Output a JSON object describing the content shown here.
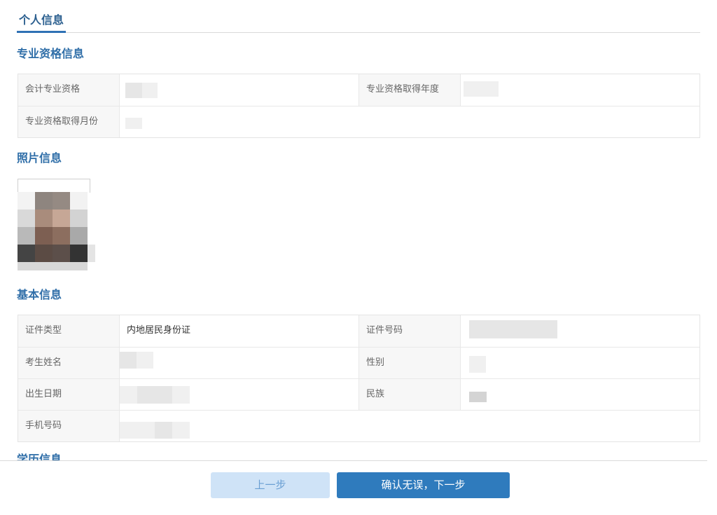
{
  "tabs": {
    "active_tab": "个人信息"
  },
  "sections": {
    "professional": "专业资格信息",
    "photo": "照片信息",
    "basic": "基本信息",
    "education": "学历信息"
  },
  "professional_fields": {
    "qualification_label": "会计专业资格",
    "year_label": "专业资格取得年度",
    "month_label": "专业资格取得月份"
  },
  "basic_fields": {
    "id_type_label": "证件类型",
    "id_type_value": "内地居民身份证",
    "id_number_label": "证件号码",
    "name_label": "考生姓名",
    "gender_label": "性别",
    "birth_label": "出生日期",
    "ethnicity_label": "民族",
    "phone_label": "手机号码"
  },
  "buttons": {
    "prev": "上一步",
    "next": "确认无误，下一步"
  },
  "colors": {
    "accent": "#2f7bbd",
    "section_title": "#2f6ea8",
    "prev_button_bg": "#cfe3f7"
  }
}
